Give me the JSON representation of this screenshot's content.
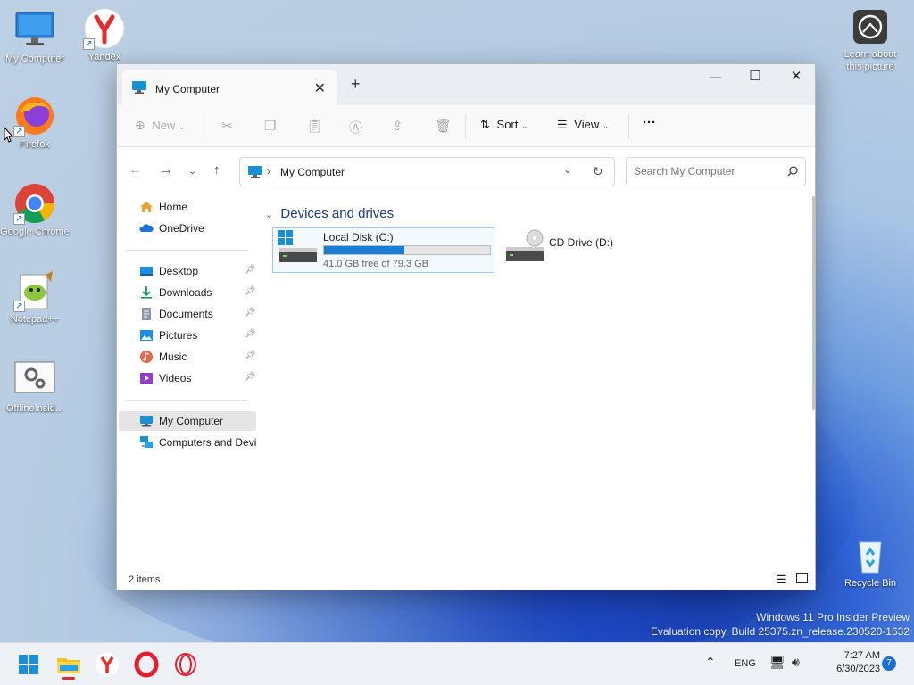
{
  "desktop": {
    "icons": [
      {
        "label": "My Computer"
      },
      {
        "label": "Yandex"
      },
      {
        "label": "Firefox"
      },
      {
        "label": "Google Chrome"
      },
      {
        "label": "Notepad++"
      },
      {
        "label": "OfflineInsid..."
      },
      {
        "label": "Learn about this picture"
      },
      {
        "label": "Recycle Bin"
      }
    ]
  },
  "explorer": {
    "tab_title": "My Computer",
    "new_tab": "+",
    "window_controls": {
      "minimize": "—",
      "maximize": "☐",
      "close": "✕"
    },
    "toolbar": {
      "new_label": "New",
      "sort_label": "Sort",
      "view_label": "View",
      "more_label": "···"
    },
    "address": {
      "crumb": "My Computer"
    },
    "search": {
      "placeholder": "Search My Computer"
    },
    "nav": {
      "items": [
        {
          "label": "Home"
        },
        {
          "label": "OneDrive"
        },
        {
          "label": "Desktop",
          "pinned": true
        },
        {
          "label": "Downloads",
          "pinned": true
        },
        {
          "label": "Documents",
          "pinned": true
        },
        {
          "label": "Pictures",
          "pinned": true
        },
        {
          "label": "Music",
          "pinned": true
        },
        {
          "label": "Videos",
          "pinned": true
        },
        {
          "label": "My Computer",
          "selected": true
        },
        {
          "label": "Computers and Devices"
        }
      ]
    },
    "section_title": "Devices and drives",
    "drives": [
      {
        "name": "Local Disk (C:)",
        "free_text": "41.0 GB free of 79.3 GB",
        "used_fraction": 0.483
      },
      {
        "name": "CD Drive (D:)"
      }
    ],
    "status": {
      "items": "2 items"
    }
  },
  "watermark": {
    "line1": "Windows 11 Pro Insider Preview",
    "line2": "Evaluation copy. Build 25375.zn_release.230520-1632"
  },
  "taskbar": {
    "tray": {
      "lang": "ENG",
      "time": "7:27 AM",
      "date": "6/30/2023",
      "notifications": "7"
    }
  },
  "colors": {
    "accent": "#1a7fd4",
    "selection": "#e5e5e5"
  }
}
